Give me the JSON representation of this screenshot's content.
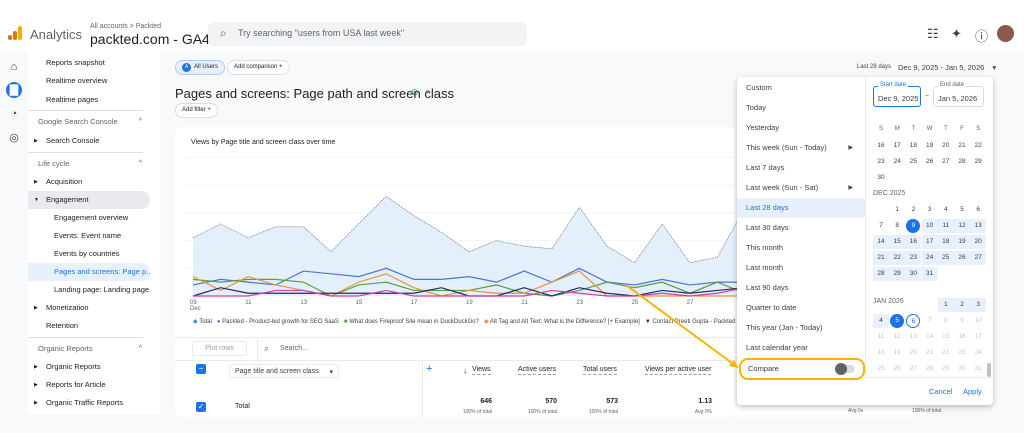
{
  "header": {
    "app_name": "Analytics",
    "breadcrumb": "All accounts > Packted",
    "property": "packted.com - GA4 ▾",
    "search_placeholder": "Try searching \"users from USA last week\"",
    "icons": [
      "apps-icon",
      "sparkle-icon",
      "help-icon",
      "avatar"
    ]
  },
  "colors": {
    "accent": "#1a73e8",
    "highlight": "#f4b400",
    "logo_bars": [
      "#f9ab00",
      "#e37400",
      "#e37400"
    ]
  },
  "sidebar": {
    "items": [
      {
        "label": "Reports snapshot",
        "kind": "item"
      },
      {
        "label": "Realtime overview",
        "kind": "item"
      },
      {
        "label": "Realtime pages",
        "kind": "item"
      },
      {
        "label": "Google Search Console",
        "kind": "section"
      },
      {
        "label": "Search Console",
        "kind": "arrow"
      },
      {
        "label": "Life cycle",
        "kind": "section"
      },
      {
        "label": "Acquisition",
        "kind": "arrow"
      },
      {
        "label": "Engagement",
        "kind": "open"
      },
      {
        "label": "Engagement overview",
        "kind": "sub"
      },
      {
        "label": "Events: Event name",
        "kind": "sub"
      },
      {
        "label": "Events by countries",
        "kind": "sub"
      },
      {
        "label": "Pages and screens: Page p...",
        "kind": "active"
      },
      {
        "label": "Landing page: Landing page",
        "kind": "sub"
      },
      {
        "label": "Monetization",
        "kind": "arrow"
      },
      {
        "label": "Retention",
        "kind": "item"
      },
      {
        "label": "Organic Reports",
        "kind": "section"
      },
      {
        "label": "Organic Reports",
        "kind": "arrow"
      },
      {
        "label": "Reports for Article",
        "kind": "arrow"
      },
      {
        "label": "Organic Traffic Reports",
        "kind": "arrow"
      }
    ]
  },
  "main": {
    "segment_chip": "All Users",
    "segment_letter": "A",
    "add_comparison": "Add comparison",
    "title": "Pages and screens: Page path and screen class",
    "add_filter": "Add filter",
    "date_label": "Last 28 days",
    "date_range": "Dec 9, 2025 - Jan 5, 2026"
  },
  "chart_data": {
    "type": "line",
    "title": "Views by Page title and screen class over time",
    "x": [
      "09 Dec",
      "10",
      "11",
      "12",
      "13",
      "14",
      "15",
      "16",
      "17",
      "18",
      "19",
      "20",
      "21",
      "22",
      "23",
      "24",
      "25",
      "26",
      "27",
      "28",
      "29"
    ],
    "x_tick_labels": [
      "09",
      "11",
      "13",
      "15",
      "17",
      "19",
      "21",
      "23",
      "25",
      "27"
    ],
    "x_tick_sublabel": "Dec",
    "grid": true,
    "legend_placement": "bottom",
    "series": [
      {
        "name": "Total",
        "color": "#8ab4f8",
        "values": [
          21,
          26,
          21,
          25,
          25,
          16,
          26,
          36,
          29,
          23,
          16,
          20,
          18,
          17,
          32,
          18,
          12,
          26,
          12,
          14,
          32
        ]
      },
      {
        "name": "Packted - Product-led growth for SEO SaaS",
        "color": "#4a74d8",
        "values": [
          4,
          6,
          5,
          4,
          9,
          8,
          7,
          10,
          6,
          6,
          7,
          5,
          9,
          5,
          10,
          5,
          4,
          6,
          4,
          5,
          5
        ]
      },
      {
        "name": "What does Fireproof Site mean in DuckDuckGo?",
        "color": "#5a9e3a",
        "values": [
          6,
          5,
          6,
          6,
          5,
          0,
          4,
          5,
          2,
          2,
          2,
          4,
          1,
          0,
          2,
          5,
          3,
          5,
          1,
          5,
          1
        ]
      },
      {
        "name": "Alt Tag and Alt Text: What is the Difference? [+ Example]",
        "color": "#e8943a",
        "values": [
          7,
          2,
          7,
          4,
          2,
          0,
          5,
          8,
          3,
          0,
          2,
          1,
          1,
          5,
          9,
          0,
          0,
          0,
          0,
          0,
          0
        ]
      },
      {
        "name": "Contact Preeti Gupta - Packted",
        "color": "#1f2a6b",
        "values": [
          0,
          3,
          1,
          1,
          1,
          1,
          1,
          1,
          1,
          3,
          0,
          0,
          3,
          0,
          3,
          1,
          0,
          2,
          1,
          2,
          3
        ]
      },
      {
        "name": "",
        "color": "#d63fa0",
        "values": [
          0,
          0,
          0,
          2,
          2,
          0,
          0,
          2,
          0,
          0,
          0,
          0,
          0,
          2,
          1,
          0,
          0,
          1,
          0,
          1,
          3
        ]
      }
    ]
  },
  "table": {
    "plot_rows": "Plot rows",
    "search_placeholder": "Search...",
    "dimension": "Page title and screen class",
    "columns": [
      "Views",
      "Active users",
      "Total users",
      "Views per active user"
    ],
    "total_row": {
      "label": "Total",
      "values": [
        "646",
        "570",
        "573",
        "1.13"
      ],
      "sub": [
        "100% of total",
        "100% of total",
        "100% of total",
        "Avg 0%"
      ]
    },
    "hidden_partial": [
      "Avg 0s",
      "100% of total"
    ]
  },
  "date_picker": {
    "options": [
      {
        "label": "Custom"
      },
      {
        "label": "Today"
      },
      {
        "label": "Yesterday"
      },
      {
        "label": "This week (Sun - Today)",
        "submenu": true
      },
      {
        "label": "Last 7 days"
      },
      {
        "label": "Last week (Sun - Sat)",
        "submenu": true
      },
      {
        "label": "Last 28 days",
        "selected": true
      },
      {
        "label": "Last 30 days"
      },
      {
        "label": "This month"
      },
      {
        "label": "Last month"
      },
      {
        "label": "Last 90 days"
      },
      {
        "label": "Quarter to date"
      },
      {
        "label": "This year (Jan - Today)"
      },
      {
        "label": "Last calendar year"
      }
    ],
    "compare_label": "Compare",
    "compare_enabled": false,
    "start_label": "Start date",
    "start_value": "Dec 9, 2025",
    "end_label": "End date",
    "end_value": "Jan 5, 2026",
    "weekdays": [
      "S",
      "M",
      "T",
      "W",
      "T",
      "F",
      "S"
    ],
    "prev_weeks": [
      [
        16,
        17,
        18,
        19,
        20,
        21,
        22
      ],
      [
        23,
        24,
        25,
        26,
        27,
        28,
        29
      ],
      [
        30,
        null,
        null,
        null,
        null,
        null,
        null
      ]
    ],
    "months": [
      {
        "name": "DEC 2025",
        "weeks": [
          [
            null,
            1,
            2,
            3,
            4,
            5,
            6
          ],
          [
            7,
            8,
            9,
            10,
            11,
            12,
            13
          ],
          [
            14,
            15,
            16,
            17,
            18,
            19,
            20
          ],
          [
            21,
            22,
            23,
            24,
            25,
            26,
            27
          ],
          [
            28,
            29,
            30,
            31,
            null,
            null,
            null
          ]
        ]
      },
      {
        "name": "JAN 2026",
        "weeks": [
          [
            null,
            null,
            null,
            null,
            1,
            2,
            3
          ],
          [
            4,
            5,
            6,
            7,
            8,
            9,
            10
          ],
          [
            11,
            12,
            13,
            14,
            15,
            16,
            17
          ],
          [
            18,
            19,
            20,
            21,
            22,
            23,
            24
          ],
          [
            25,
            26,
            27,
            28,
            29,
            30,
            31
          ]
        ]
      }
    ],
    "cancel": "Cancel",
    "apply": "Apply"
  }
}
